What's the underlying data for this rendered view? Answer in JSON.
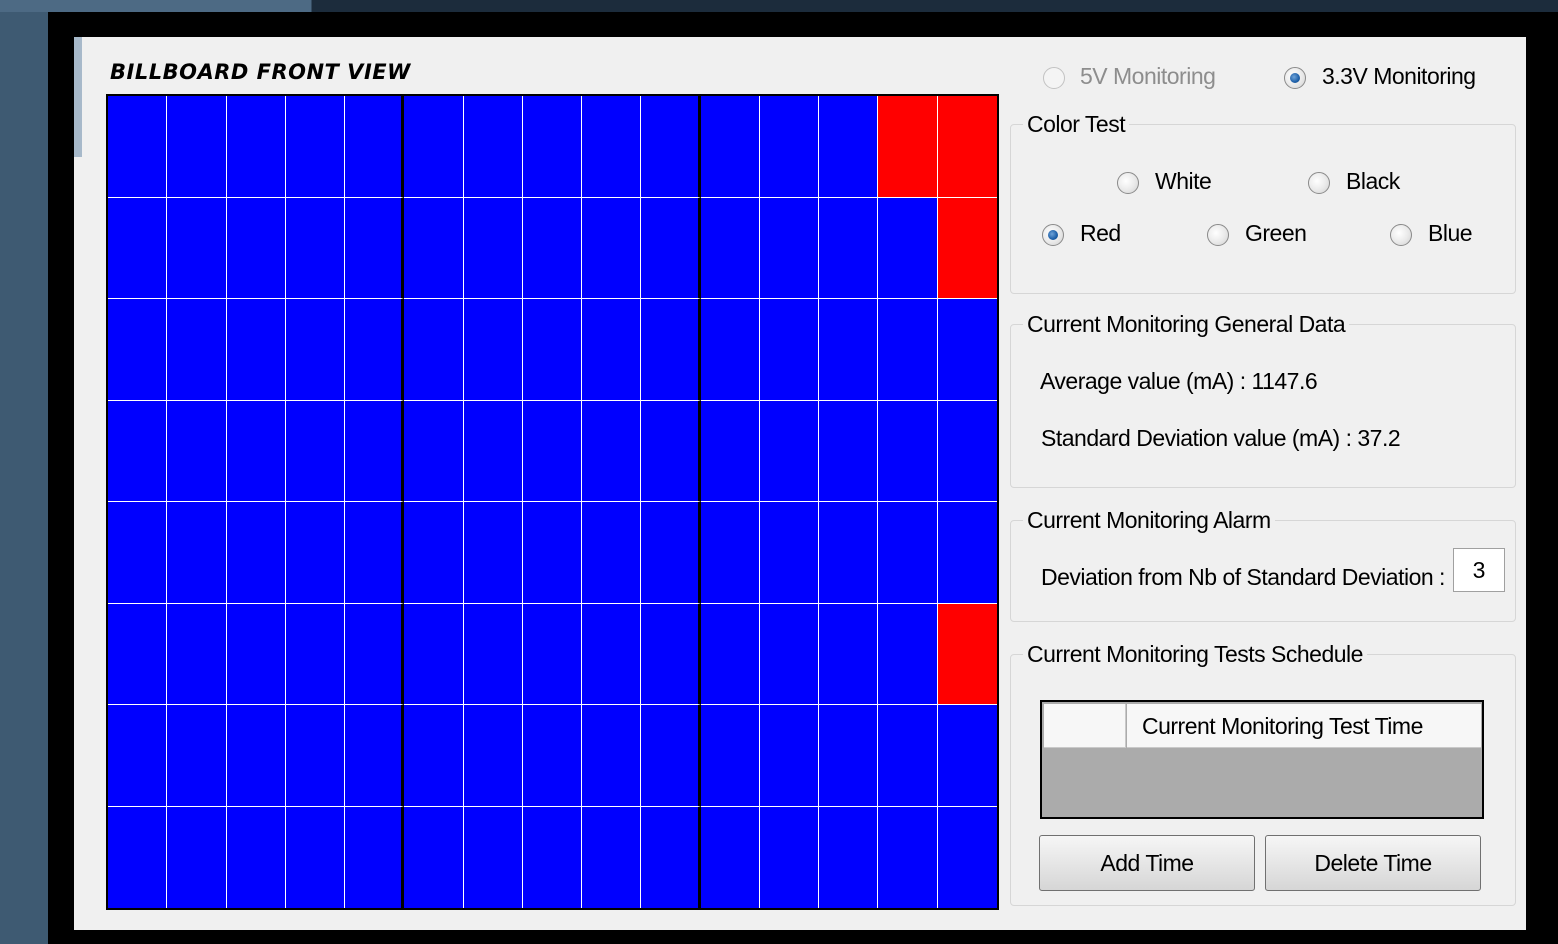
{
  "billboard": {
    "title": "BILLBOARD FRONT VIEW",
    "rows": 8,
    "cols": 15,
    "colors": {
      "off": "#0000ff",
      "on": "#ff0000"
    },
    "red_cells": [
      [
        1,
        14
      ],
      [
        1,
        15
      ],
      [
        2,
        15
      ],
      [
        6,
        15
      ]
    ]
  },
  "monitoring": {
    "v5_label": "5V Monitoring",
    "v33_label": "3.3V Monitoring",
    "selected": "3.3V Monitoring"
  },
  "color_test": {
    "legend": "Color Test",
    "options": [
      "White",
      "Black",
      "Red",
      "Green",
      "Blue"
    ],
    "selected": "Red"
  },
  "general_data": {
    "legend": "Current Monitoring General Data",
    "average_label": "Average value (mA) : 1147.6",
    "std_label": "Standard Deviation value (mA) : 37.2"
  },
  "alarm": {
    "legend": "Current Monitoring Alarm",
    "deviation_label": "Deviation from Nb of Standard Deviation :",
    "deviation_value": "3"
  },
  "schedule": {
    "legend": "Current Monitoring Tests Schedule",
    "column_header": "Current Monitoring Test Time",
    "rows": [],
    "add_label": "Add Time",
    "delete_label": "Delete Time"
  }
}
